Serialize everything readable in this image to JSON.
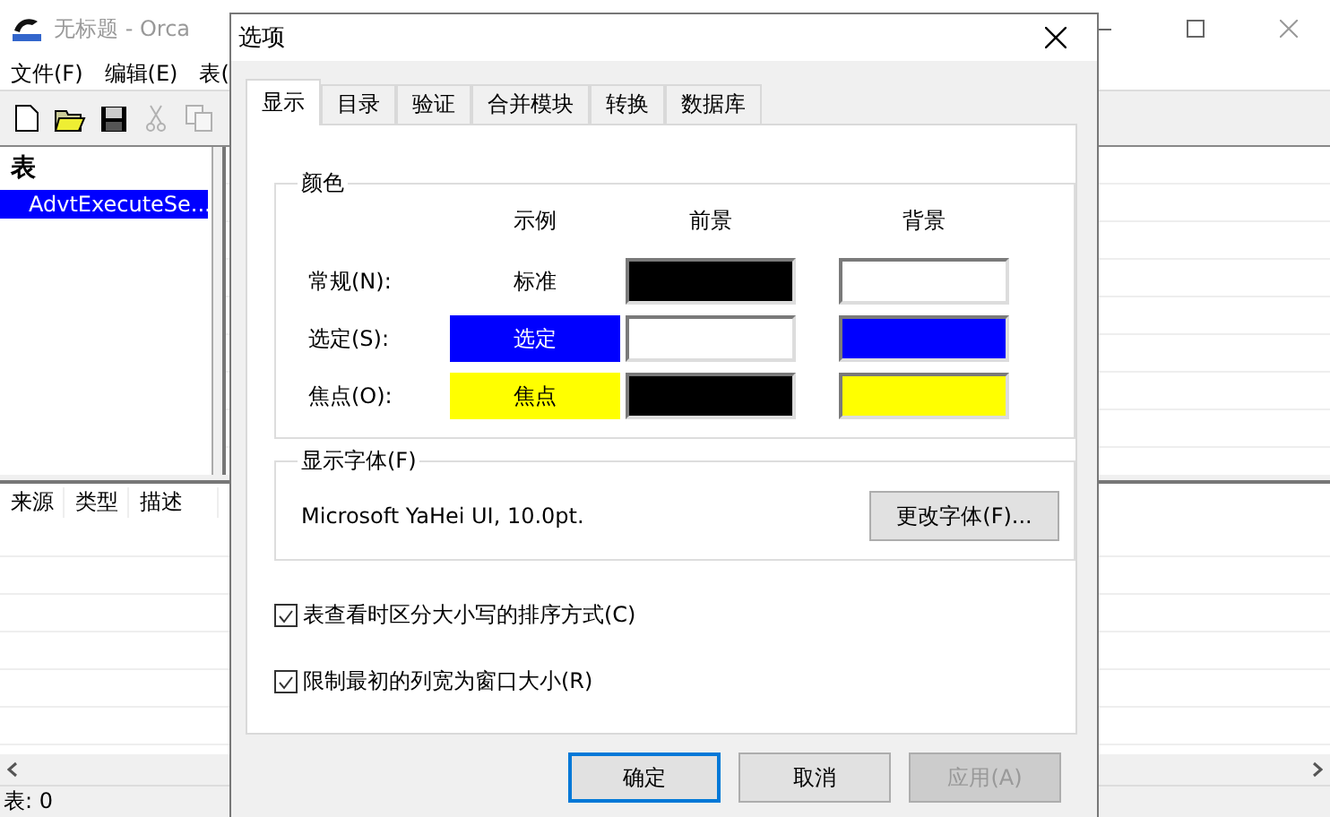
{
  "main_window": {
    "title": "无标题 - Orca",
    "menu": [
      "文件(F)",
      "编辑(E)",
      "表("
    ],
    "toolbar": [
      {
        "kind": "new",
        "disabled": false
      },
      {
        "kind": "open",
        "disabled": false
      },
      {
        "kind": "save",
        "disabled": false
      },
      {
        "kind": "cut",
        "disabled": true
      },
      {
        "kind": "copy",
        "disabled": true
      }
    ],
    "tables_header": "表",
    "tables": [
      {
        "name": "AdvtExecuteSe...",
        "selected": true
      }
    ],
    "bottom_columns": [
      "来源",
      "类型",
      "描述"
    ],
    "status": "表: 0"
  },
  "dialog": {
    "title": "选项",
    "tabs": [
      {
        "label": "显示",
        "selected": true
      },
      {
        "label": "目录",
        "selected": false
      },
      {
        "label": "验证",
        "selected": false
      },
      {
        "label": "合并模块",
        "selected": false
      },
      {
        "label": "转换",
        "selected": false
      },
      {
        "label": "数据库",
        "selected": false
      }
    ],
    "color_group": {
      "title": "颜色",
      "headers": [
        "示例",
        "前景",
        "背景"
      ],
      "rows": [
        {
          "label": "常规(N):",
          "sample": "标准",
          "foreground": {
            "color": "#000000"
          },
          "background": {
            "color": "#ffffff"
          }
        },
        {
          "label": "选定(S):",
          "sample": "选定",
          "foreground": {
            "color": "#ffffff"
          },
          "background": {
            "color": "#0000ff"
          }
        },
        {
          "label": "焦点(O):",
          "sample": "焦点",
          "foreground": {
            "color": "#000000"
          },
          "background": {
            "color": "#ffff00"
          }
        }
      ]
    },
    "font_group": {
      "title": "显示字体(F)",
      "font": "Microsoft YaHei UI, 10.0pt.",
      "button": "更改字体(F)..."
    },
    "checkboxes": [
      {
        "label": "表查看时区分大小写的排序方式(C)",
        "checked": true
      },
      {
        "label": "限制最初的列宽为窗口大小(R)",
        "checked": true
      }
    ],
    "buttons": [
      {
        "label": "确定",
        "default": true,
        "disabled": false
      },
      {
        "label": "取消",
        "default": false,
        "disabled": false
      },
      {
        "label": "应用(A)",
        "default": false,
        "disabled": true
      }
    ]
  }
}
